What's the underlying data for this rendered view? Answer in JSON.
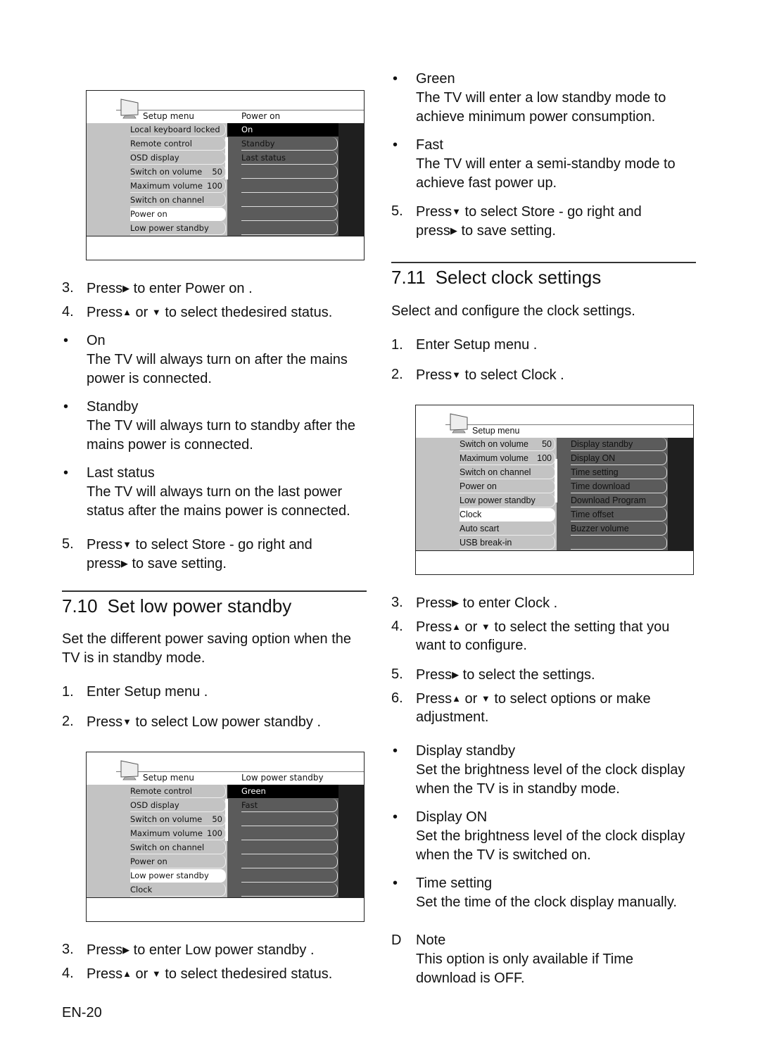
{
  "page_number": "EN-20",
  "icons": {
    "right": "▶",
    "up": "▲",
    "down": "▼",
    "bullet": "•",
    "note": "D"
  },
  "left_col": {
    "menu1": {
      "title": "Setup menu",
      "submenu_title": "Power on",
      "left_items": [
        {
          "label": "Local keyboard locked",
          "value": ""
        },
        {
          "label": "Remote control",
          "value": ""
        },
        {
          "label": "OSD display",
          "value": ""
        },
        {
          "label": "Switch on volume",
          "value": "50"
        },
        {
          "label": "Maximum volume",
          "value": "100"
        },
        {
          "label": "Switch on channel",
          "value": ""
        },
        {
          "label": "Power on",
          "value": "",
          "selected": true
        },
        {
          "label": "Low power standby",
          "value": ""
        }
      ],
      "right_items": [
        "On",
        "Standby",
        "Last status",
        "",
        "",
        "",
        "",
        ""
      ],
      "right_selected": 0
    },
    "steps_a": [
      {
        "num": "3.",
        "pre": "Press",
        "key": "▶",
        "post": " to enter Power on ."
      },
      {
        "num": "4.",
        "pre": "Press",
        "key": "▲",
        "mid": " or ",
        "key2": "▼",
        "post": " to select thedesired status."
      }
    ],
    "bullets": [
      {
        "title": "On",
        "lines": [
          "The TV will always turn on after the mains",
          "power is connected."
        ]
      },
      {
        "title": "Standby",
        "lines": [
          "The TV will always turn to standby after the",
          "mains power is connected."
        ]
      },
      {
        "title": "Last status",
        "lines": [
          "The TV will always turn on the last power",
          "status after the mains power is connected."
        ]
      }
    ],
    "step5": {
      "num": "5.",
      "line1_pre": "Press",
      "key": "▼",
      "line1_post": " to select Store - go right   and",
      "line2_pre": "press",
      "key2": "▶",
      "line2_post": " to save setting."
    },
    "section": {
      "heading_num": "7.10",
      "heading": "Set low power standby",
      "intro": [
        "Set the different power saving option when the",
        "TV is in standby mode."
      ],
      "steps": [
        {
          "num": "1.",
          "text": "Enter Setup  menu ."
        },
        {
          "num": "2.",
          "pre": "Press",
          "key": "▼",
          "post": " to select Low power standby  ."
        }
      ]
    },
    "menu2": {
      "title": "Setup menu",
      "submenu_title": "Low power standby",
      "left_items": [
        {
          "label": "Remote control",
          "value": ""
        },
        {
          "label": "OSD display",
          "value": ""
        },
        {
          "label": "Switch on volume",
          "value": "50"
        },
        {
          "label": "Maximum volume",
          "value": "100"
        },
        {
          "label": "Switch on channel",
          "value": ""
        },
        {
          "label": "Power on",
          "value": ""
        },
        {
          "label": "Low power standby",
          "value": "",
          "selected": true
        },
        {
          "label": "Clock",
          "value": ""
        }
      ],
      "right_items": [
        "Green",
        "Fast",
        "",
        "",
        "",
        "",
        "",
        ""
      ],
      "right_selected": 0
    },
    "steps_b": [
      {
        "num": "3.",
        "pre": "Press",
        "key": "▶",
        "post": " to enter Low power standby  ."
      },
      {
        "num": "4.",
        "pre": "Press",
        "key": "▲",
        "mid": " or ",
        "key2": "▼",
        "post": " to select thedesired status."
      }
    ]
  },
  "right_col": {
    "bullets": [
      {
        "title": "Green",
        "lines": [
          "The TV will enter a low standby mode to",
          "achieve minimum power consumption."
        ]
      },
      {
        "title": "Fast",
        "lines": [
          "The TV will enter a semi-standby mode to",
          "achieve fast power up."
        ]
      }
    ],
    "step5": {
      "num": "5.",
      "line1_pre": "Press",
      "key": "▼",
      "line1_post": " to select Store - go right   and",
      "line2_pre": "press",
      "key2": "▶",
      "line2_post": " to save setting."
    },
    "section": {
      "heading_num": "7.11",
      "heading": "Select clock  settings",
      "intro": "Select and configure the clock settings.",
      "steps": [
        {
          "num": "1.",
          "text": "Enter Setup  menu ."
        },
        {
          "num": "2.",
          "pre": "Press",
          "key": "▼",
          "post": " to select Clock ."
        }
      ]
    },
    "menu3": {
      "title": "Setup menu",
      "submenu_title": "",
      "left_items": [
        {
          "label": "Switch on volume",
          "value": "50"
        },
        {
          "label": "Maximum volume",
          "value": "100"
        },
        {
          "label": "Switch on channel",
          "value": ""
        },
        {
          "label": "Power on",
          "value": ""
        },
        {
          "label": "Low power standby",
          "value": ""
        },
        {
          "label": "Clock",
          "value": "",
          "selected": true
        },
        {
          "label": "Auto scart",
          "value": ""
        },
        {
          "label": "USB break-in",
          "value": ""
        }
      ],
      "right_items": [
        "Display standby",
        "Display ON",
        "Time setting",
        "Time download",
        "Download Program",
        "Time offset",
        "Buzzer volume",
        ""
      ]
    },
    "steps": [
      {
        "num": "3.",
        "pre": "Press",
        "key": "▶",
        "post": " to enter Clock ."
      },
      {
        "num": "4.",
        "pre": "Press",
        "key": "▲",
        "mid": " or ",
        "key2": "▼",
        "post": " to select the setting that you",
        "line2": "want to configure."
      },
      {
        "num": "5.",
        "pre": "Press",
        "key": "▶",
        "post": " to select the settings."
      },
      {
        "num": "6.",
        "pre": "Press",
        "key": "▲",
        "mid": " or ",
        "key2": "▼",
        "post": " to select options or make",
        "line2": "adjustment."
      }
    ],
    "clock_bullets": [
      {
        "title": "Display standby",
        "lines": [
          "Set the brightness level of the clock display",
          "when the TV is in standby mode."
        ]
      },
      {
        "title": "Display ON",
        "lines": [
          "Set the brightness level of the clock display",
          "when the TV is switched on."
        ]
      },
      {
        "title": "Time setting",
        "lines": [
          "Set the time of the clock display manually."
        ]
      }
    ],
    "note": {
      "title": "Note",
      "lines": [
        "This option is only available if Time",
        "download  is OFF."
      ]
    }
  }
}
